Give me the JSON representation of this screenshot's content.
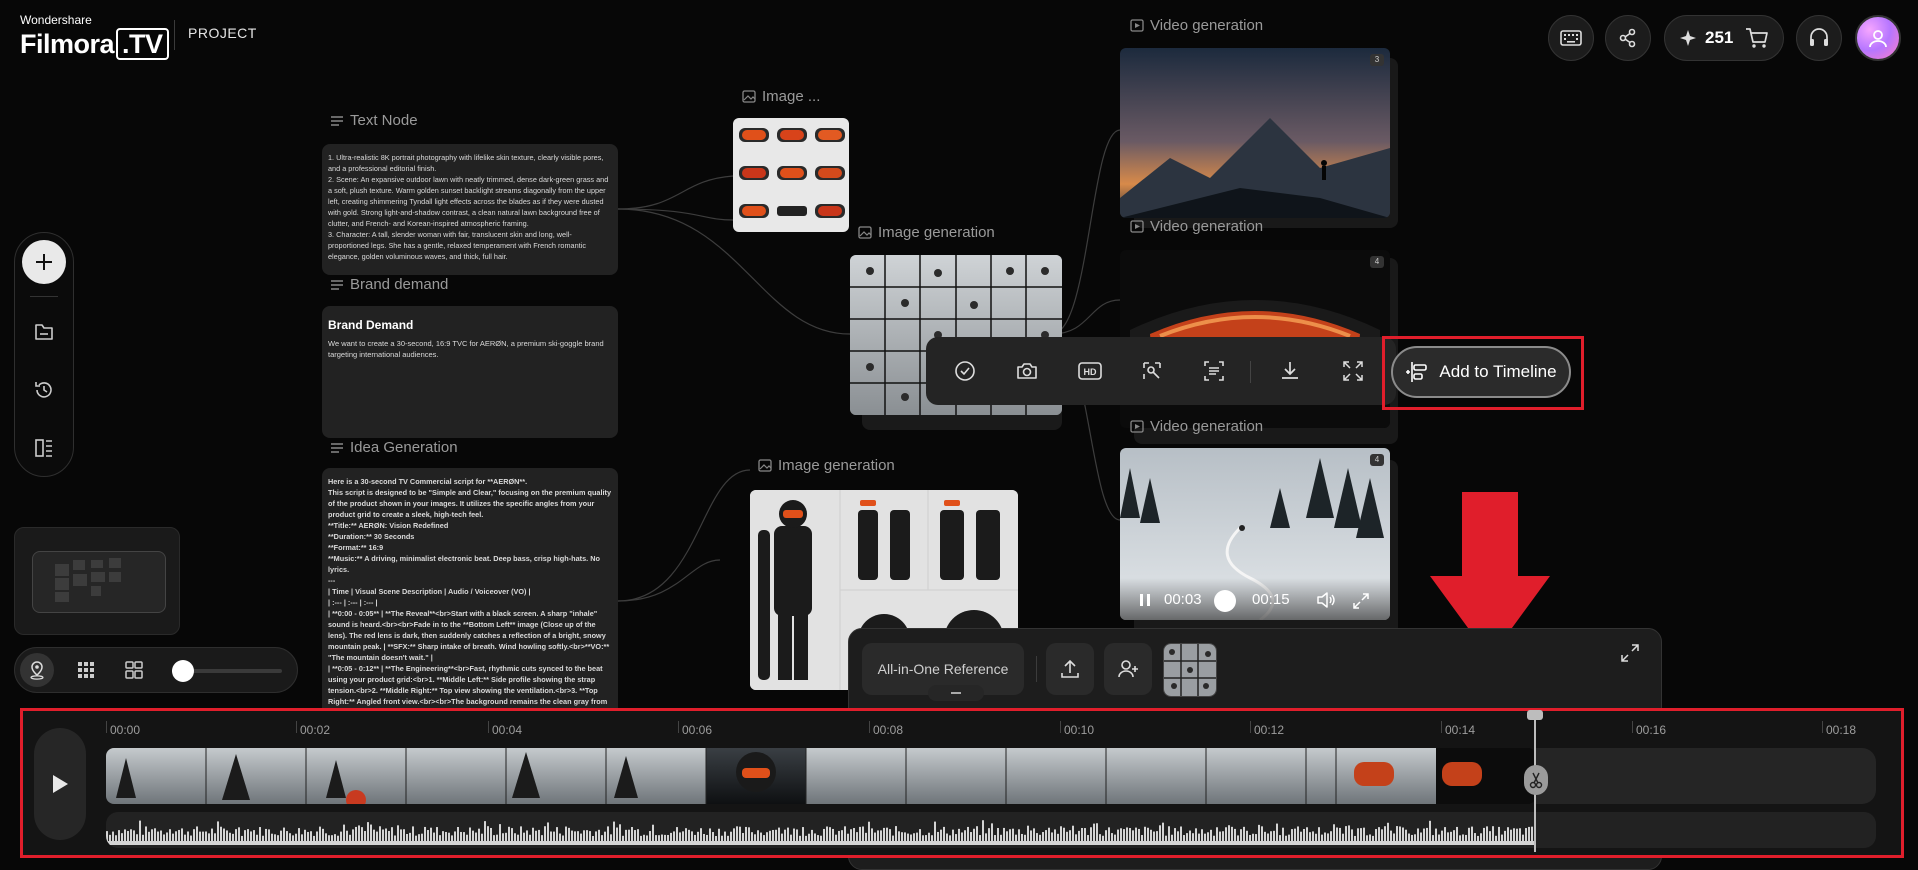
{
  "header": {
    "brand_top": "Wondershare",
    "brand_name": "Filmora",
    "brand_suffix": ".TV",
    "project_label": "PROJECT",
    "credits": "251",
    "icons": [
      "keyboard-icon",
      "share-icon",
      "sparkle-icon",
      "cart-icon",
      "headset-icon"
    ]
  },
  "nodes": {
    "text_node": {
      "title": "Text Node",
      "lines": [
        "1. Ultra-realistic 8K portrait photography with lifelike skin texture, clearly visible pores, and a professional editorial finish.",
        "2. Scene: An expansive outdoor lawn with neatly trimmed, dense dark-green grass and a soft, plush texture. Warm golden sunset backlight streams diagonally from the upper left, creating shimmering Tyndall light effects across the blades as if they were dusted with gold. Strong light-and-shadow contrast, a clean natural lawn background free of clutter, and French- and Korean-inspired atmospheric framing.",
        "3. Character: A tall, slender woman with fair, translucent skin and long, well-proportioned legs. She has a gentle, relaxed temperament with French romantic elegance, golden voluminous waves, and thick, full hair."
      ]
    },
    "brand_demand": {
      "title": "Brand demand",
      "heading": "Brand Demand",
      "body": "We want to create a 30-second, 16:9 TVC for AERØN, a premium ski-goggle brand targeting international audiences."
    },
    "idea_generation": {
      "title": "Idea Generation",
      "lines": [
        "Here is a 30-second TV Commercial script for **AERØN**.",
        "This script is designed to be \"Simple and Clear,\" focusing on the premium quality of the product shown in your images. It utilizes the specific angles from your product grid to create a sleek, high-tech feel.",
        "**Title:** AERØN: Vision Redefined",
        "**Duration:** 30 Seconds",
        "**Format:** 16:9",
        "**Music:** A driving, minimalist electronic beat. Deep bass, crisp high-hats. No lyrics.",
        "---",
        "| Time | Visual Scene Description | Audio / Voiceover (VO) |",
        "| :--- | :--- | :--- |",
        "| **0:00 - 0:05** | **The Reveal**<br>Start with a black screen. A sharp \"inhale\" sound is heard.<br><br>Fade in to the **Bottom Left** image (Close up of the lens). The red lens is dark, then suddenly catches a reflection of a bright, snowy mountain peak. | **SFX:** Sharp intake of breath. Wind howling softly.<br>**VO:** \"The mountain doesn't wait.\" |",
        "| **0:05 - 0:12** | **The Engineering**<br>Fast, rhythmic cuts synced to the beat using your product grid:<br>1. **Middle Left:** Side profile showing the strap tension.<br>2. **Middle Right:** Top view showing the ventilation.<br>3. **Top Right:** Angled front view.<br><br>The background remains the clean gray from your"
      ]
    },
    "image_small": {
      "title": "Image ..."
    },
    "image_gen_1": {
      "title": "Image generation"
    },
    "image_gen_2": {
      "title": "Image generation"
    },
    "video_gen_1": {
      "title": "Video generation",
      "badge": "3"
    },
    "video_gen_2": {
      "title": "Video generation",
      "badge": "4"
    },
    "video_gen_3": {
      "title": "Video generation",
      "badge": "4",
      "current_time": "00:03",
      "duration": "00:15",
      "progress": 0.2
    }
  },
  "floating_toolbar": {
    "icons": [
      "check-circle-icon",
      "camera-icon",
      "hd-icon",
      "crop-edit-icon",
      "scan-text-icon",
      "download-icon",
      "fullscreen-icon"
    ],
    "add_to_timeline": "Add to Timeline"
  },
  "input_panel": {
    "reference_button": "All-in-One Reference",
    "icons": [
      "upload-icon",
      "add-person-icon",
      "expand-icon"
    ]
  },
  "timeline": {
    "ticks": [
      "00:00",
      "00:02",
      "00:04",
      "00:06",
      "00:08",
      "00:10",
      "00:12",
      "00:14",
      "00:16",
      "00:18"
    ],
    "playhead_time": "00:15"
  },
  "zoom": {
    "level": 0.1
  },
  "colors": {
    "highlight": "#e01e2b",
    "goggle_lens": "#e0501a",
    "background": "#070707"
  }
}
